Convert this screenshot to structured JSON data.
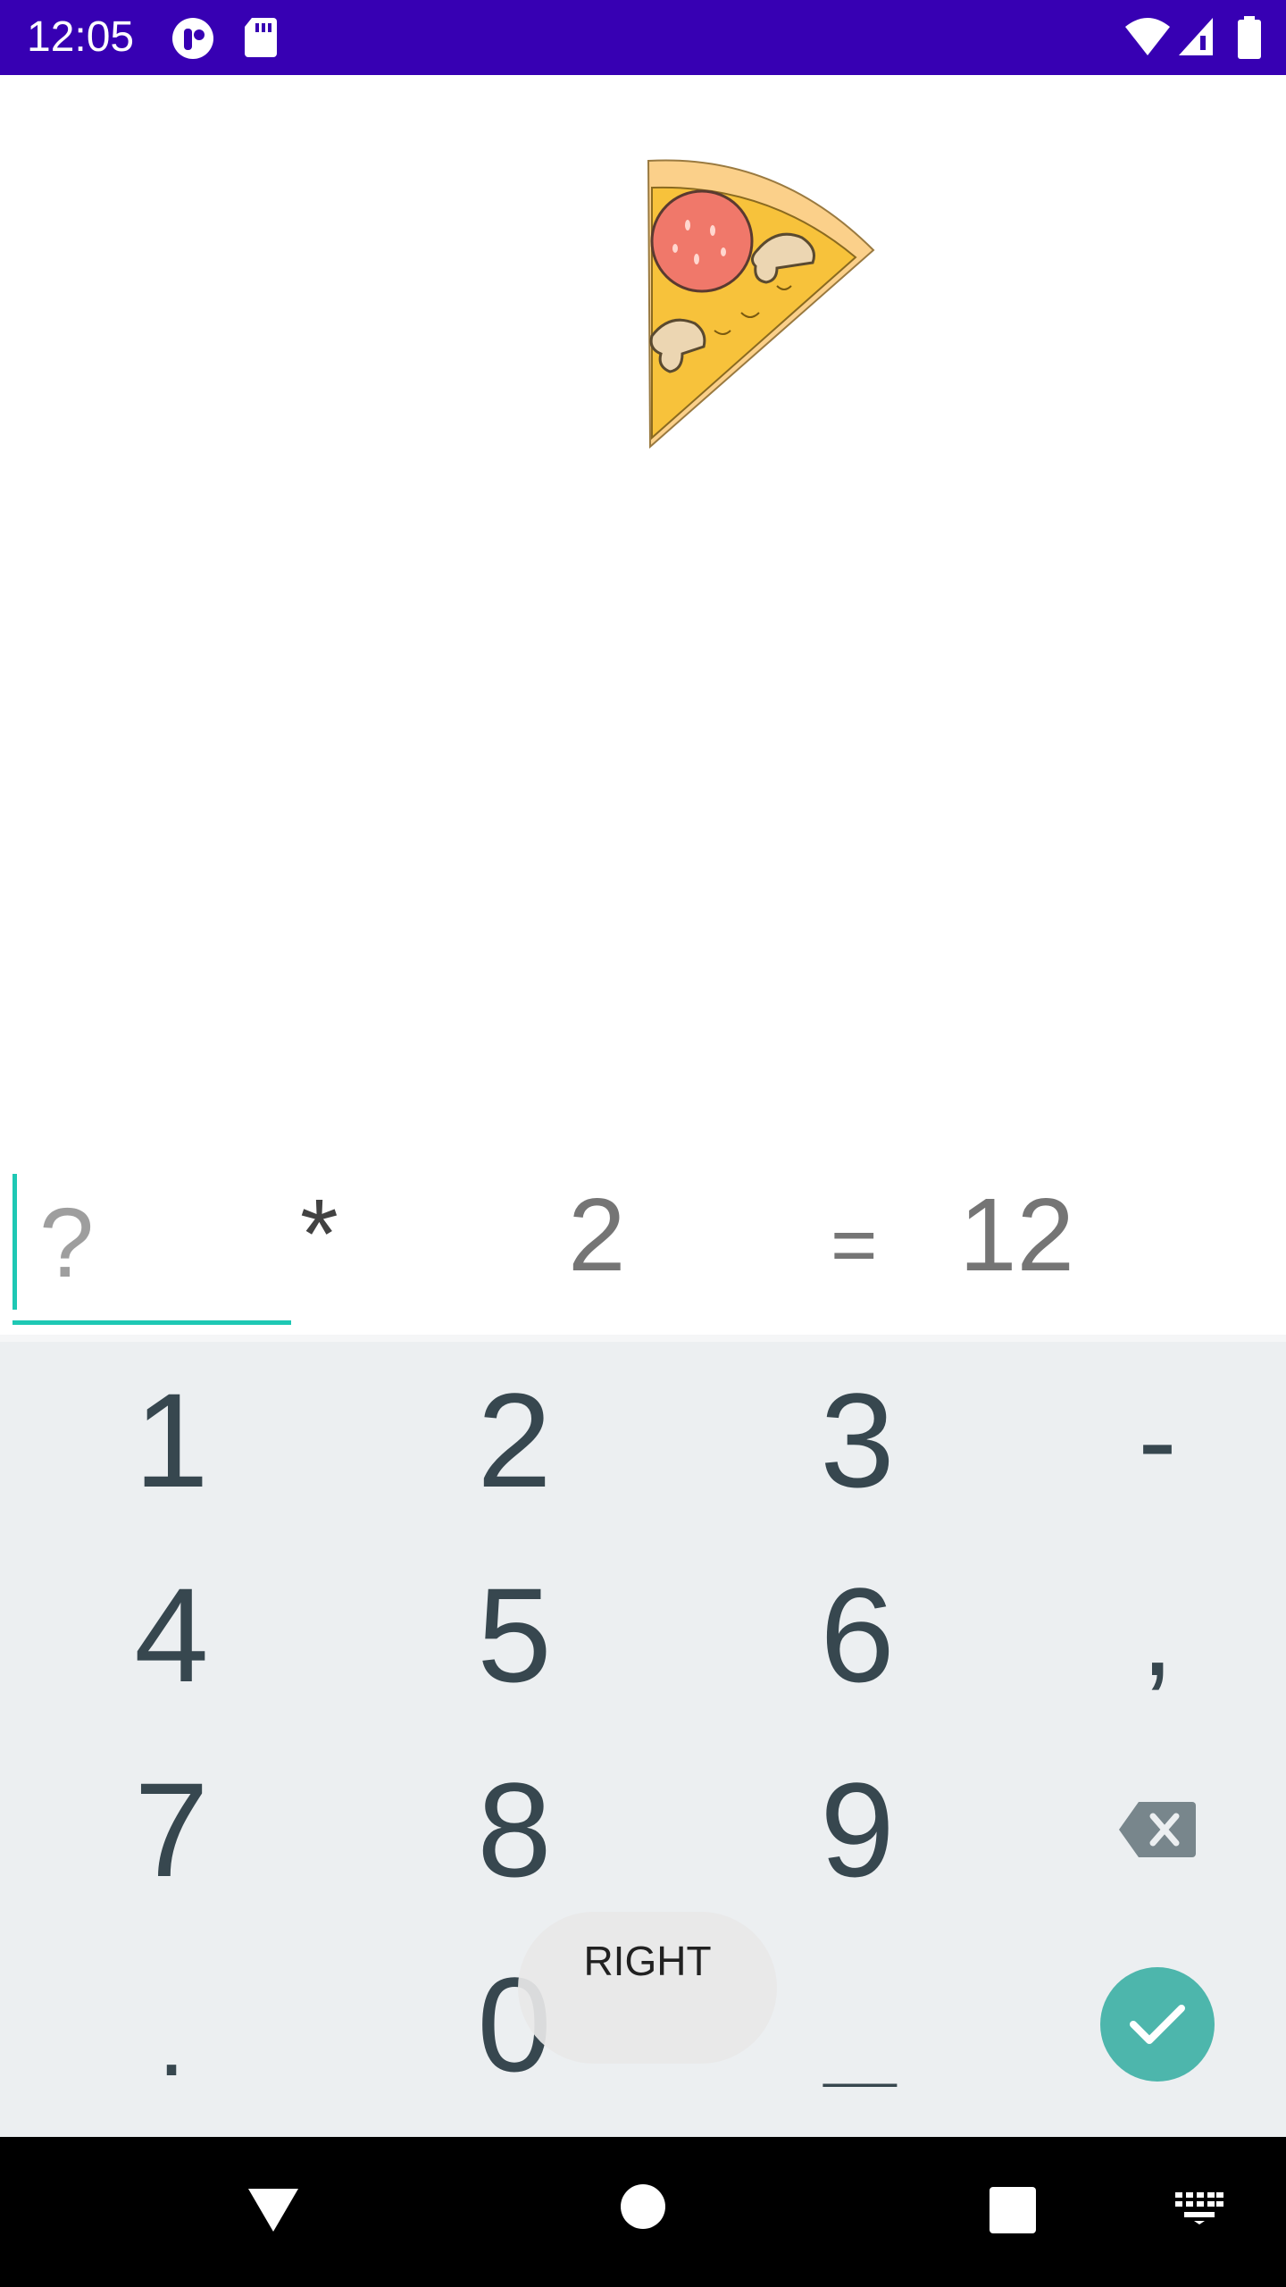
{
  "status_bar": {
    "time": "12:05",
    "icons": [
      "notification-app-icon",
      "sd-card-icon",
      "wifi-icon",
      "signal-icon",
      "battery-icon"
    ],
    "background": "#3700b3"
  },
  "illustration": {
    "icon": "pizza-slice-icon"
  },
  "equation": {
    "answer_placeholder": "?",
    "operator": "*",
    "operand": "2",
    "equals": "=",
    "result": "12",
    "accent_color": "#1ec8b4"
  },
  "keyboard": {
    "keys": {
      "k1": "1",
      "k2": "2",
      "k3": "3",
      "minus": "-",
      "k4": "4",
      "k5": "5",
      "k6": "6",
      "comma": ",",
      "k7": "7",
      "k8": "8",
      "k9": "9",
      "dot": ".",
      "k0": "0",
      "space": "___"
    },
    "background": "#eceff1",
    "done_color": "#4db6ac"
  },
  "toast": {
    "text": "RIGHT"
  },
  "nav_bar": {
    "icons": [
      "back-icon",
      "home-icon",
      "recents-icon",
      "keyboard-switch-icon"
    ]
  }
}
